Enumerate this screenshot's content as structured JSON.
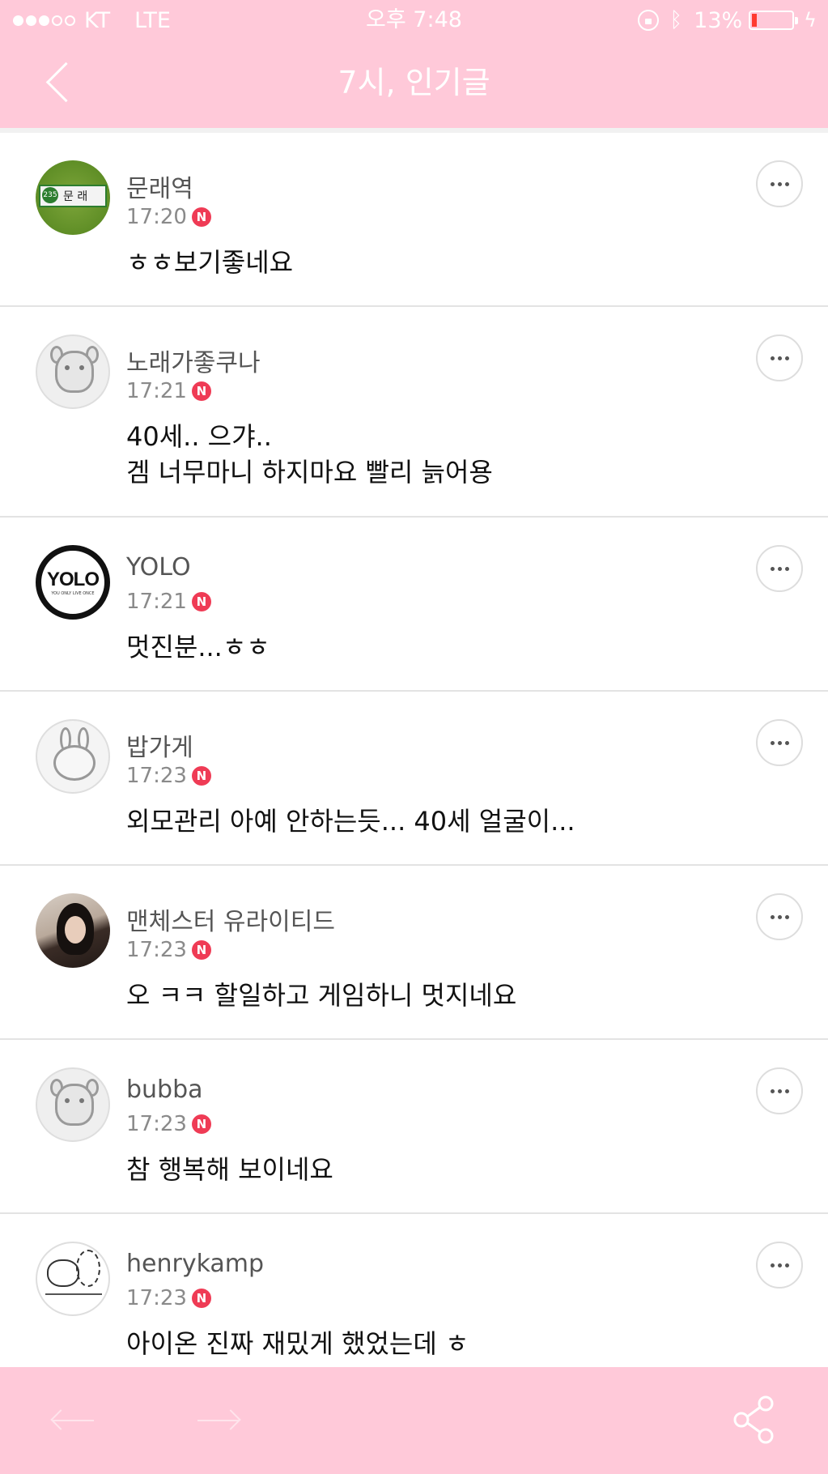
{
  "status_bar": {
    "carrier": "KT",
    "network": "LTE",
    "time": "오후 7:48",
    "battery_percent_text": "13%",
    "battery_level": 0.13,
    "signal_bars_filled": 3,
    "signal_bars_total": 5
  },
  "nav": {
    "back_icon": "chevron-left-icon",
    "title": "7시, 인기글"
  },
  "colors": {
    "header_bg": "#ffc9d9",
    "new_badge": "#ef3b55",
    "battery_low": "#ff3b30"
  },
  "comments": [
    {
      "name": "문래역",
      "time": "17:20",
      "badge": "N",
      "text": "ㅎㅎ보기좋네요",
      "avatar": "subway-station-sign",
      "avatar_text": "문 래",
      "avatar_num": "235"
    },
    {
      "name": "노래가좋쿠나",
      "time": "17:21",
      "badge": "N",
      "text": "40세.. 으갸..\n겜 너무마니 하지마요 빨리 늙어용",
      "avatar": "grey-dog-cartoon"
    },
    {
      "name": "YOLO",
      "time": "17:21",
      "badge": "N",
      "text": "멋진분...ㅎㅎ",
      "avatar": "yolo-logo",
      "avatar_text": "YOLO",
      "avatar_subtext": "YOU ONLY LIVE ONCE"
    },
    {
      "name": "밥가게",
      "time": "17:23",
      "badge": "N",
      "text": "외모관리 아예 안하는듯... 40세 얼굴이...",
      "avatar": "grey-bunny-cartoon"
    },
    {
      "name": "맨체스터 유라이티드",
      "time": "17:23",
      "badge": "N",
      "text": "오 ㅋㅋ 할일하고 게임하니 멋지네요",
      "avatar": "user-photo"
    },
    {
      "name": "bubba",
      "time": "17:23",
      "badge": "N",
      "text": "참 행복해 보이네요",
      "avatar": "grey-dog-cartoon"
    },
    {
      "name": "henrykamp",
      "time": "17:23",
      "badge": "N",
      "text": "아이온 진짜 재밌게 했었는데 ㅎ",
      "avatar": "sketch-cat-drawing"
    }
  ],
  "more_icon": "more-dots-icon",
  "bottom_bar": {
    "back_icon": "arrow-left-icon",
    "forward_icon": "arrow-right-icon",
    "share_icon": "share-icon"
  }
}
